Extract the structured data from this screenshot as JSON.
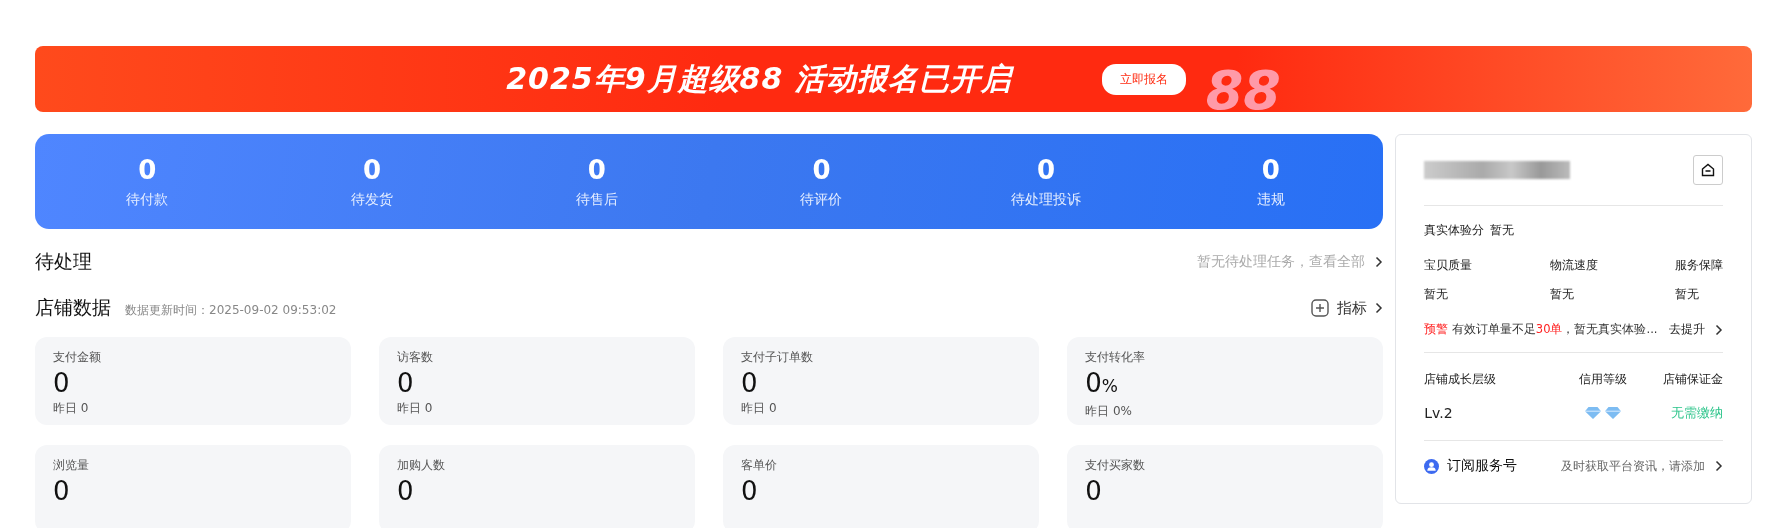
{
  "banner": {
    "title": "2025年9月超级88 活动报名已开启",
    "button": "立即报名",
    "badge": "88"
  },
  "order_stats": [
    {
      "value": "0",
      "label": "待付款"
    },
    {
      "value": "0",
      "label": "待发货"
    },
    {
      "value": "0",
      "label": "待售后"
    },
    {
      "value": "0",
      "label": "待评价"
    },
    {
      "value": "0",
      "label": "待处理投诉"
    },
    {
      "value": "0",
      "label": "违规"
    }
  ],
  "pending": {
    "title": "待处理",
    "link": "暂无待处理任务，查看全部"
  },
  "store_data": {
    "title": "店铺数据",
    "updated": "数据更新时间：2025-09-02 09:53:02",
    "metrics_button": "指标",
    "cards": [
      {
        "label": "支付金额",
        "value": "0",
        "yesterday": "昨日  0"
      },
      {
        "label": "访客数",
        "value": "0",
        "yesterday": "昨日  0"
      },
      {
        "label": "支付子订单数",
        "value": "0",
        "yesterday": "昨日  0"
      },
      {
        "label": "支付转化率",
        "value": "0",
        "unit": "%",
        "yesterday": "昨日  0%"
      },
      {
        "label": "浏览量",
        "value": "0"
      },
      {
        "label": "加购人数",
        "value": "0"
      },
      {
        "label": "客单价",
        "value": "0"
      },
      {
        "label": "支付买家数",
        "value": "0"
      }
    ]
  },
  "shop_panel": {
    "score_label": "真实体验分",
    "score_value": "暂无",
    "sub_scores": [
      {
        "label": "宝贝质量",
        "value": "暂无"
      },
      {
        "label": "物流速度",
        "value": "暂无"
      },
      {
        "label": "服务保障",
        "value": "暂无"
      }
    ],
    "warning": [
      {
        "text": "预警",
        "highlight": true
      },
      {
        "text": " 有效订单量不足",
        "highlight": false
      },
      {
        "text": "30单",
        "highlight": true
      },
      {
        "text": "，暂无真实体验...",
        "highlight": false
      }
    ],
    "warning_link": "去提升",
    "levels": [
      {
        "label": "店铺成长层级",
        "value": "Lv.2",
        "kind": "text"
      },
      {
        "label": "信用等级",
        "kind": "diamonds"
      },
      {
        "label": "店铺保证金",
        "value": "无需缴纳",
        "kind": "good"
      }
    ],
    "subscribe": {
      "label": "订阅服务号",
      "hint": "及时获取平台资讯，请添加"
    }
  }
}
